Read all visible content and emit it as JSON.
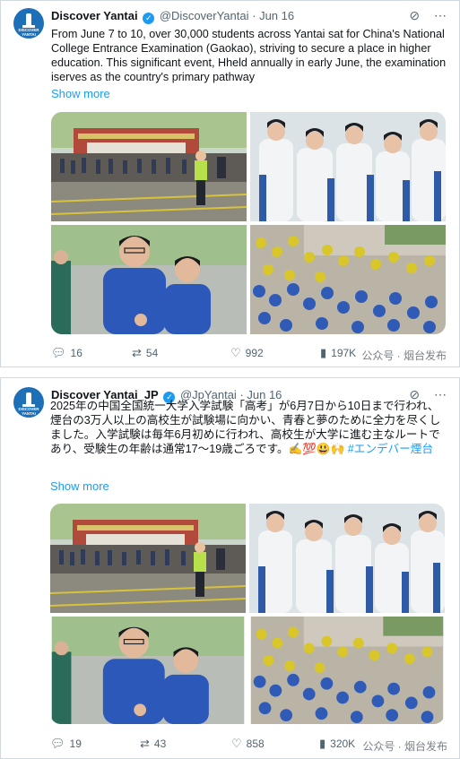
{
  "tweets": [
    {
      "name": "Discover Yantai",
      "handle": "@DiscoverYantai",
      "date": "· Jun 16",
      "text": "From June 7 to 10, over 30,000 students across Yantai sat for China's National College Entrance Examination (Gaokao), striving to secure a place in higher education. This significant event, Hheld annually in early June, the examination iserves as the country's primary pathway",
      "hashtag": "",
      "show_more": "Show more",
      "replies": "16",
      "reposts": "54",
      "likes": "992",
      "views": "197K",
      "watermark": "公众号 · 烟台发布"
    },
    {
      "name": "Discover Yantai_JP",
      "handle": "@JpYantai",
      "date": "· Jun 16",
      "text": "2025年の中国全国統一大学入学試験「高考」が6月7日から10日まで行われ、煙台の3万人以上の高校生が試験場に向かい、青春と夢のために全力を尽くしました。入学試験は毎年6月初めに行われ、高校生が大学に進む主なルートであり、受験生の年齢は通常17～19歳ごろです。✍️💯😃🙌",
      "hashtag": "#エンデバー煙台",
      "show_more": "Show more",
      "replies": "19",
      "reposts": "43",
      "likes": "858",
      "views": "320K",
      "watermark": "公众号 · 烟台发布"
    }
  ],
  "avatar_text": "DISCOVER YANTAI",
  "icons": {
    "verified": "verified-badge-icon",
    "grok": "grok-icon",
    "more": "more-icon",
    "reply": "reply-icon",
    "repost": "repost-icon",
    "like": "like-icon",
    "views": "views-icon"
  },
  "colors": {
    "accent": "#1d9bf0",
    "muted": "#536471",
    "brand": "#1d6fb8"
  }
}
